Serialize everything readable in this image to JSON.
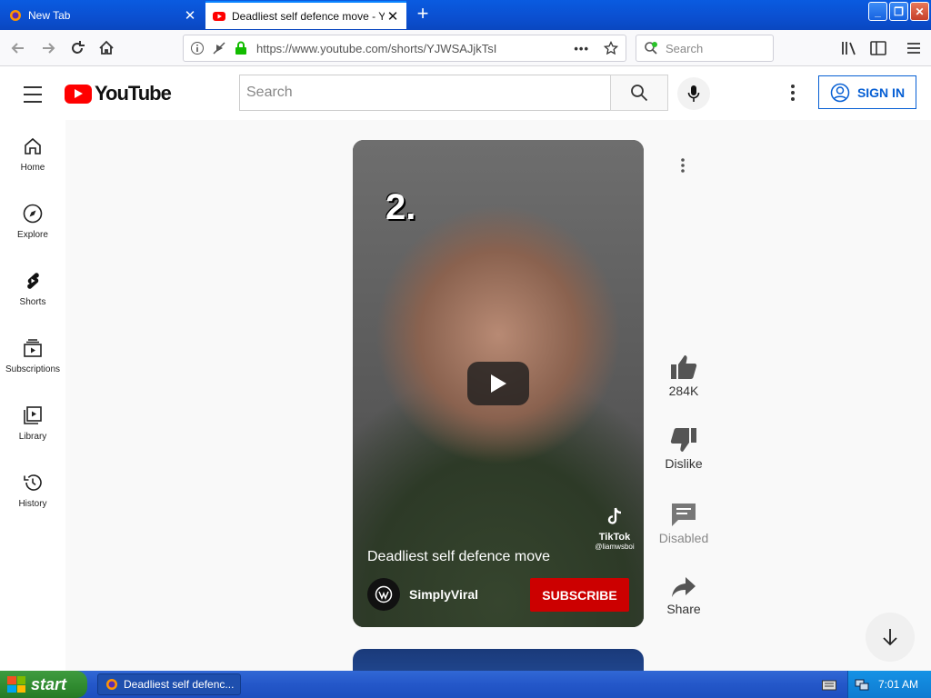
{
  "browser": {
    "tabs": [
      {
        "label": "New Tab",
        "active": false
      },
      {
        "label": "Deadliest self defence move - YouTube",
        "active": true
      }
    ],
    "address": "https://www.youtube.com/shorts/YJWSAJjkTsI",
    "search_placeholder": "Search"
  },
  "youtube": {
    "logo_text": "YouTube",
    "search_placeholder": "Search",
    "sign_in_label": "SIGN IN",
    "sidebar": [
      {
        "label": "Home",
        "icon": "home-icon"
      },
      {
        "label": "Explore",
        "icon": "compass-icon"
      },
      {
        "label": "Shorts",
        "icon": "shorts-icon"
      },
      {
        "label": "Subscriptions",
        "icon": "subscriptions-icon"
      },
      {
        "label": "Library",
        "icon": "library-icon"
      },
      {
        "label": "History",
        "icon": "history-icon"
      }
    ],
    "short": {
      "overlay_number": "2.",
      "title": "Deadliest self defence move",
      "channel": "SimplyViral",
      "subscribe_label": "SUBSCRIBE",
      "watermark_name": "TikTok",
      "watermark_user": "@liamwsboi"
    },
    "actions": {
      "likes": "284K",
      "dislike_label": "Dislike",
      "comments_label": "Disabled",
      "share_label": "Share"
    },
    "colors": {
      "brand_red": "#ff0000",
      "subscribe_red": "#cc0000",
      "link_blue": "#065fd4"
    }
  },
  "taskbar": {
    "start_label": "start",
    "task_label": "Deadliest self defenc...",
    "clock": "7:01 AM"
  }
}
